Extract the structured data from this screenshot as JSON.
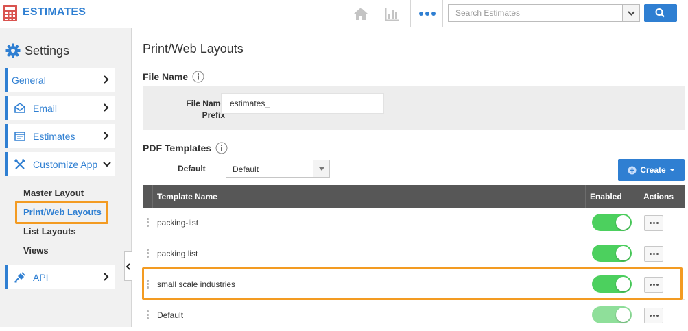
{
  "header": {
    "app_title": "ESTIMATES",
    "search_placeholder": "Search Estimates",
    "accent": "#2f7fd2"
  },
  "sidebar": {
    "title": "Settings",
    "items": [
      {
        "label": "General",
        "icon": "none"
      },
      {
        "label": "Email",
        "icon": "envelope-icon"
      },
      {
        "label": "Estimates",
        "icon": "document-icon"
      },
      {
        "label": "Customize App",
        "icon": "tools-icon",
        "expanded": true
      },
      {
        "label": "API",
        "icon": "plug-icon"
      }
    ],
    "sub_items": [
      "Master Layout",
      "Print/Web Layouts",
      "List Layouts",
      "Views"
    ],
    "active_sub_item": "Print/Web Layouts"
  },
  "main": {
    "page_title": "Print/Web Layouts",
    "file_name": {
      "section_title": "File Name",
      "label_line1": "File Name",
      "label_line2": "Prefix",
      "value": "estimates_"
    },
    "pdf_templates": {
      "section_title": "PDF Templates",
      "default_label": "Default",
      "default_value": "Default",
      "create_label": "Create"
    },
    "table": {
      "columns": [
        "Template Name",
        "Enabled",
        "Actions"
      ],
      "rows": [
        {
          "name": "packing-list",
          "enabled": true
        },
        {
          "name": "packing list",
          "enabled": true
        },
        {
          "name": "small scale industries",
          "enabled": true,
          "highlighted": true
        },
        {
          "name": "Default",
          "enabled": true,
          "locked": true
        }
      ]
    }
  }
}
